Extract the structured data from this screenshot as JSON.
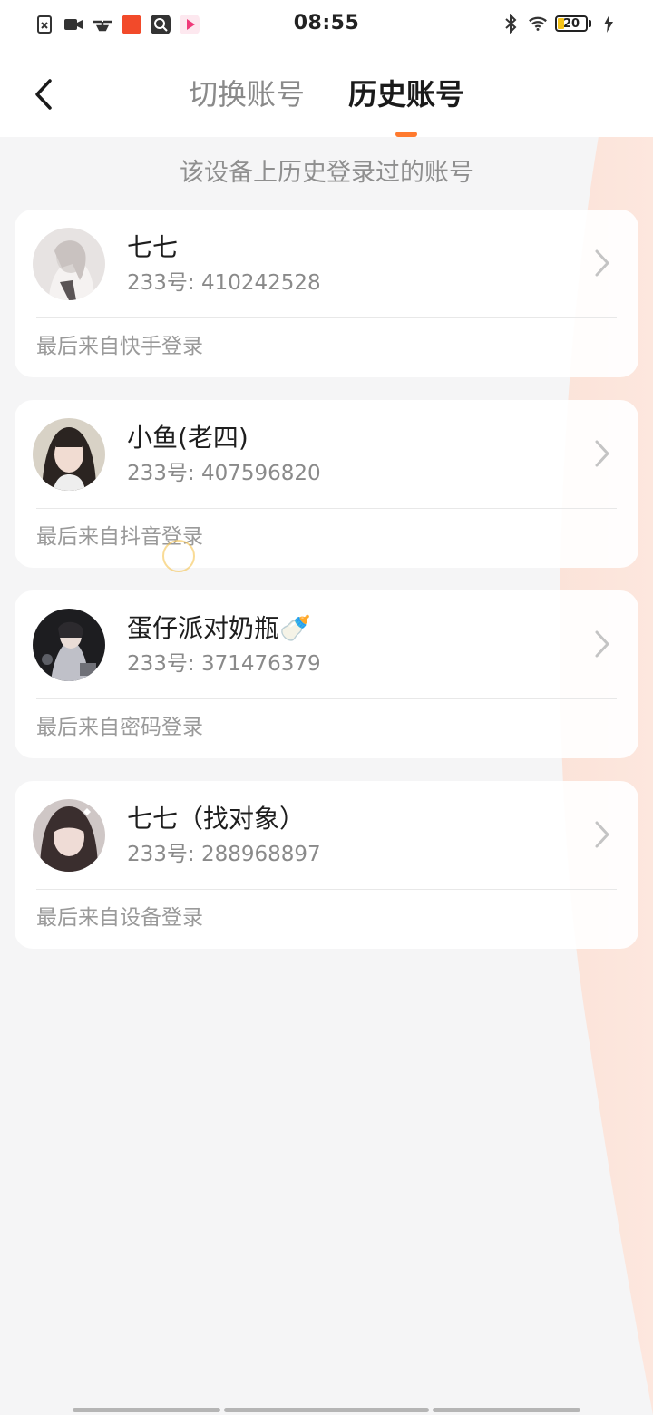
{
  "status_bar": {
    "time": "08:55",
    "battery": "20",
    "left_icons": [
      "file-x-icon",
      "video-icon",
      "drone-icon",
      "app-red-icon",
      "app-search-icon",
      "app-video-icon"
    ],
    "right_icons": [
      "bluetooth-icon",
      "wifi-icon",
      "battery-icon",
      "charging-icon"
    ]
  },
  "header": {
    "tabs": [
      {
        "label": "切换账号",
        "active": false
      },
      {
        "label": "历史账号",
        "active": true
      }
    ],
    "accent_color": "#ff7a2e"
  },
  "main": {
    "subtitle": "该设备上历史登录过的账号",
    "accounts": [
      {
        "name": "七七",
        "id_text": "233号: 410242528",
        "source": "最后来自快手登录"
      },
      {
        "name": "小鱼(老四)",
        "id_text": "233号: 407596820",
        "source": "最后来自抖音登录"
      },
      {
        "name": "蛋仔派对奶瓶🍼",
        "id_text": "233号: 371476379",
        "source": "最后来自密码登录"
      },
      {
        "name": "七七（找对象）",
        "id_text": "233号: 288968897",
        "source": "最后来自设备登录"
      }
    ]
  }
}
